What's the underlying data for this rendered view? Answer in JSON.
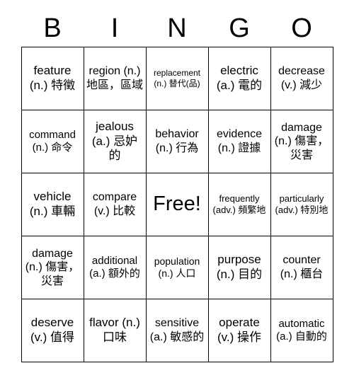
{
  "card": {
    "title": "BINGO",
    "header_letters": [
      "B",
      "I",
      "N",
      "G",
      "O"
    ],
    "columns": 5,
    "rows": 5,
    "free_space": {
      "row": 3,
      "column": 3,
      "label": "Free!"
    },
    "border_color": "#000000",
    "text_color": "#000000",
    "background_color": "#ffffff",
    "cells": [
      [
        {
          "text": "feature (n.) 特徵",
          "word": "feature",
          "part_of_speech": "(n.)",
          "translation": "特徵",
          "size": "fs-17"
        },
        {
          "text": "region (n.) 地區，區域",
          "word": "region",
          "part_of_speech": "(n.)",
          "translation": "地區，區域",
          "size": "fs-16"
        },
        {
          "text": "replacement (n.) 替代(品)",
          "word": "replacement",
          "part_of_speech": "(n.)",
          "translation": "替代(品)",
          "size": "fs-12"
        },
        {
          "text": "electric (a.) 電的",
          "word": "electric",
          "part_of_speech": "(a.)",
          "translation": "電的",
          "size": "fs-17"
        },
        {
          "text": "decrease (v.) 減少",
          "word": "decrease",
          "part_of_speech": "(v.)",
          "translation": "減少",
          "size": "fs-16"
        }
      ],
      [
        {
          "text": "command (n.) 命令",
          "word": "command",
          "part_of_speech": "(n.)",
          "translation": "命令",
          "size": "fs-15"
        },
        {
          "text": "jealous (a.) 忌妒的",
          "word": "jealous",
          "part_of_speech": "(a.)",
          "translation": "忌妒的",
          "size": "fs-17"
        },
        {
          "text": "behavior (n.) 行為",
          "word": "behavior",
          "part_of_speech": "(n.)",
          "translation": "行為",
          "size": "fs-16"
        },
        {
          "text": "evidence (n.) 證據",
          "word": "evidence",
          "part_of_speech": "(n.)",
          "translation": "證據",
          "size": "fs-16"
        },
        {
          "text": "damage (n.) 傷害，災害",
          "word": "damage",
          "part_of_speech": "(n.)",
          "translation": "傷害，災害",
          "size": "fs-16"
        }
      ],
      [
        {
          "text": "vehicle (n.) 車輛",
          "word": "vehicle",
          "part_of_speech": "(n.)",
          "translation": "車輛",
          "size": "fs-17"
        },
        {
          "text": "compare (v.) 比較",
          "word": "compare",
          "part_of_speech": "(v.)",
          "translation": "比較",
          "size": "fs-16"
        },
        {
          "text": "Free!",
          "word": "Free!",
          "part_of_speech": "",
          "translation": "",
          "size": "fs-17"
        },
        {
          "text": "frequently (adv.) 頻繁地",
          "word": "frequently",
          "part_of_speech": "(adv.)",
          "translation": "頻繁地",
          "size": "fs-13"
        },
        {
          "text": "particularly (adv.) 特別地",
          "word": "particularly",
          "part_of_speech": "(adv.)",
          "translation": "特別地",
          "size": "fs-13"
        }
      ],
      [
        {
          "text": "damage (n.) 傷害，災害",
          "word": "damage",
          "part_of_speech": "(n.)",
          "translation": "傷害，災害",
          "size": "fs-16"
        },
        {
          "text": "additional (a.) 額外的",
          "word": "additional",
          "part_of_speech": "(a.)",
          "translation": "額外的",
          "size": "fs-15"
        },
        {
          "text": "population (n.) 人口",
          "word": "population",
          "part_of_speech": "(n.)",
          "translation": "人口",
          "size": "fs-14"
        },
        {
          "text": "purpose (n.) 目的",
          "word": "purpose",
          "part_of_speech": "(n.)",
          "translation": "目的",
          "size": "fs-17"
        },
        {
          "text": "counter (n.) 櫃台",
          "word": "counter",
          "part_of_speech": "(n.)",
          "translation": "櫃台",
          "size": "fs-16"
        }
      ],
      [
        {
          "text": "deserve (v.) 值得",
          "word": "deserve",
          "part_of_speech": "(v.)",
          "translation": "值得",
          "size": "fs-17"
        },
        {
          "text": "flavor (n.) 口味",
          "word": "flavor",
          "part_of_speech": "(n.)",
          "translation": "口味",
          "size": "fs-17"
        },
        {
          "text": "sensitive (a.) 敏感的",
          "word": "sensitive",
          "part_of_speech": "(a.)",
          "translation": "敏感的",
          "size": "fs-16"
        },
        {
          "text": "operate (v.) 操作",
          "word": "operate",
          "part_of_speech": "(v.)",
          "translation": "操作",
          "size": "fs-17"
        },
        {
          "text": "automatic (a.) 自動的",
          "word": "automatic",
          "part_of_speech": "(a.)",
          "translation": "自動的",
          "size": "fs-15"
        }
      ]
    ]
  }
}
